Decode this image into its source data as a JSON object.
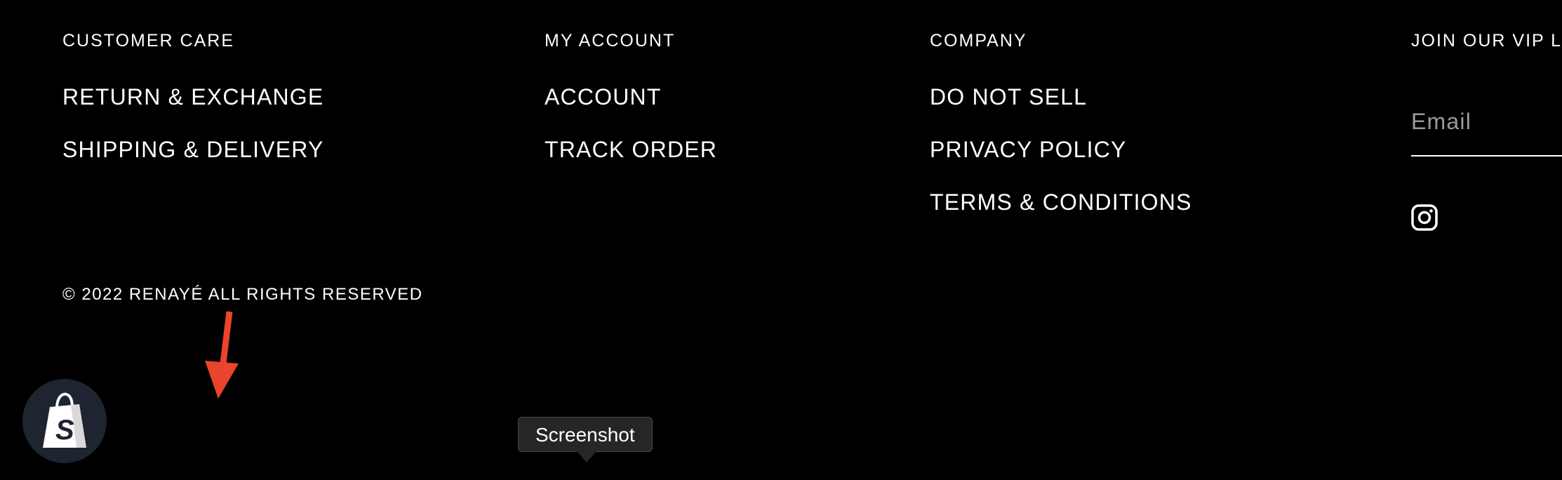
{
  "footer": {
    "customer_care": {
      "title": "CUSTOMER CARE",
      "links": [
        "RETURN & EXCHANGE",
        "SHIPPING & DELIVERY"
      ]
    },
    "my_account": {
      "title": "MY ACCOUNT",
      "links": [
        "ACCOUNT",
        "TRACK ORDER"
      ]
    },
    "company": {
      "title": "COMPANY",
      "links": [
        "DO NOT SELL",
        "PRIVACY POLICY",
        "TERMS & CONDITIONS"
      ]
    },
    "vip": {
      "title": "JOIN OUR VIP LIS",
      "email_placeholder": "Email",
      "email_value": "",
      "social_icon": "instagram-icon"
    },
    "copyright": "© 2022 RENAYÉ ALL RIGHTS RESERVED"
  },
  "overlay": {
    "arrow_color": "#e8452c",
    "shopify_icon": "shopify-bag-icon",
    "tooltip": "Screenshot"
  },
  "colors": {
    "background": "#000000",
    "text": "#ffffff",
    "placeholder": "#9a9a9a",
    "shopify_button": "#1e2430"
  }
}
